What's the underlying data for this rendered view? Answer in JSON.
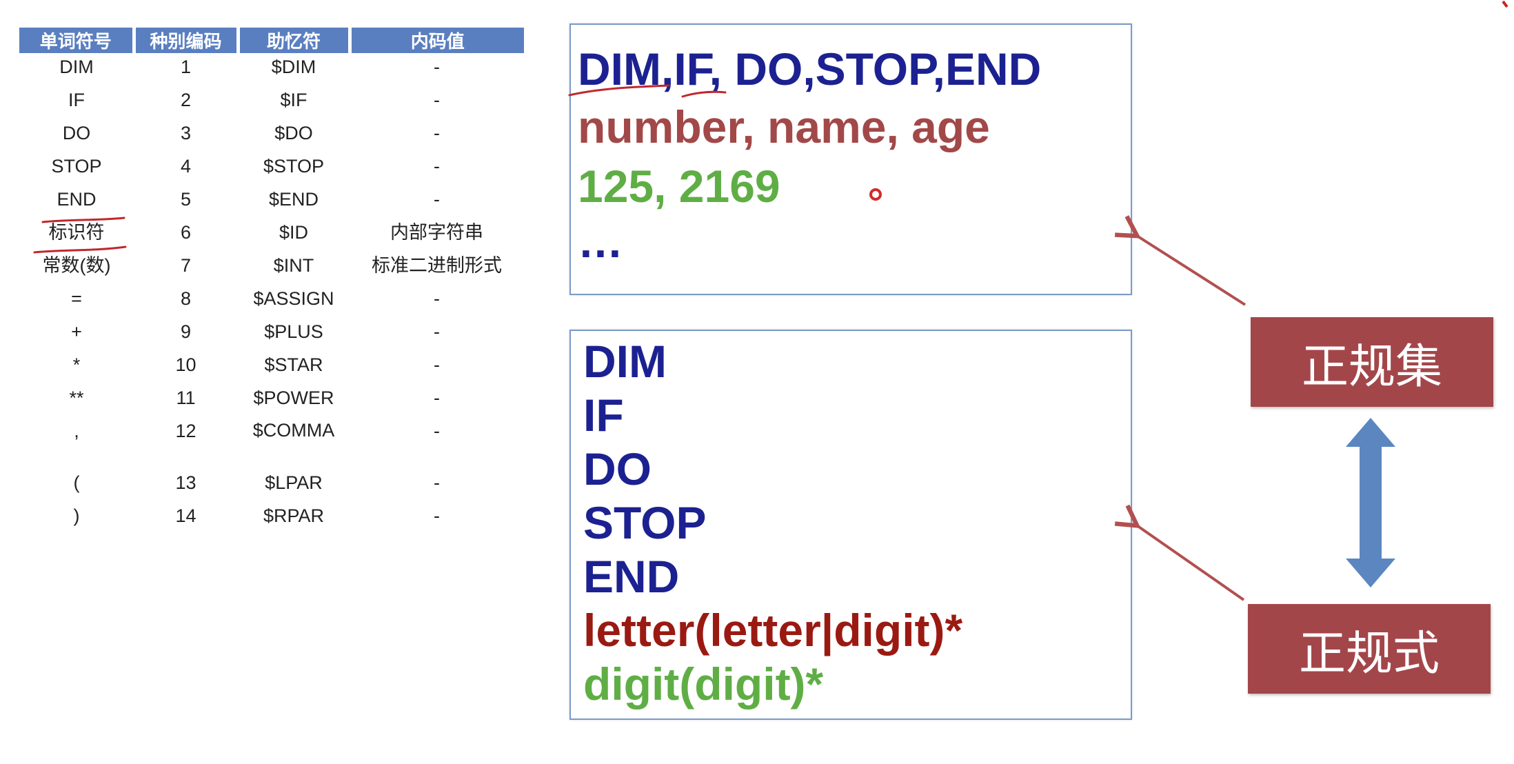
{
  "table": {
    "headers": [
      "单词符号",
      "种别编码",
      "助忆符",
      "内码值"
    ],
    "rows": [
      [
        "DIM",
        "1",
        "$DIM",
        "-"
      ],
      [
        "IF",
        "2",
        "$IF",
        "-"
      ],
      [
        "DO",
        "3",
        "$DO",
        "-"
      ],
      [
        "STOP",
        "4",
        "$STOP",
        "-"
      ],
      [
        "END",
        "5",
        "$END",
        "-"
      ],
      [
        "标识符",
        "6",
        "$ID",
        "内部字符串"
      ],
      [
        "常数(数)",
        "7",
        "$INT",
        "标准二进制形式"
      ],
      [
        "=",
        "8",
        "$ASSIGN",
        "-"
      ],
      [
        "+",
        "9",
        "$PLUS",
        "-"
      ],
      [
        "*",
        "10",
        "$STAR",
        "-"
      ],
      [
        "**",
        "11",
        "$POWER",
        "-"
      ],
      [
        ",",
        "12",
        "$COMMA",
        "-"
      ],
      [
        "(",
        "13",
        "$LPAR",
        "-"
      ],
      [
        ")",
        "14",
        "$RPAR",
        "-"
      ]
    ],
    "header_color": "#5a7fc0"
  },
  "regular_set": {
    "keywords": "DIM,IF, DO,STOP,END",
    "identifiers": "number, name, age",
    "constants": "125, 2169",
    "ellipsis": "…"
  },
  "regex": {
    "lines": [
      "DIM",
      "IF",
      "DO",
      "STOP",
      "END"
    ],
    "identifier_rule": "letter(letter|digit)*",
    "constant_rule": "digit(digit)*"
  },
  "labels": {
    "regular_set": "正规集",
    "regular_expression": "正规式"
  },
  "colors": {
    "keyword": "#1c2191",
    "identifier": "#a24848",
    "constant": "#5fae45",
    "label_bg": "#a3464a",
    "arrow": "#5b86c0"
  },
  "icons": {
    "double_arrow": "double-arrow-icon",
    "pointer_arrow": "arrow-icon"
  }
}
